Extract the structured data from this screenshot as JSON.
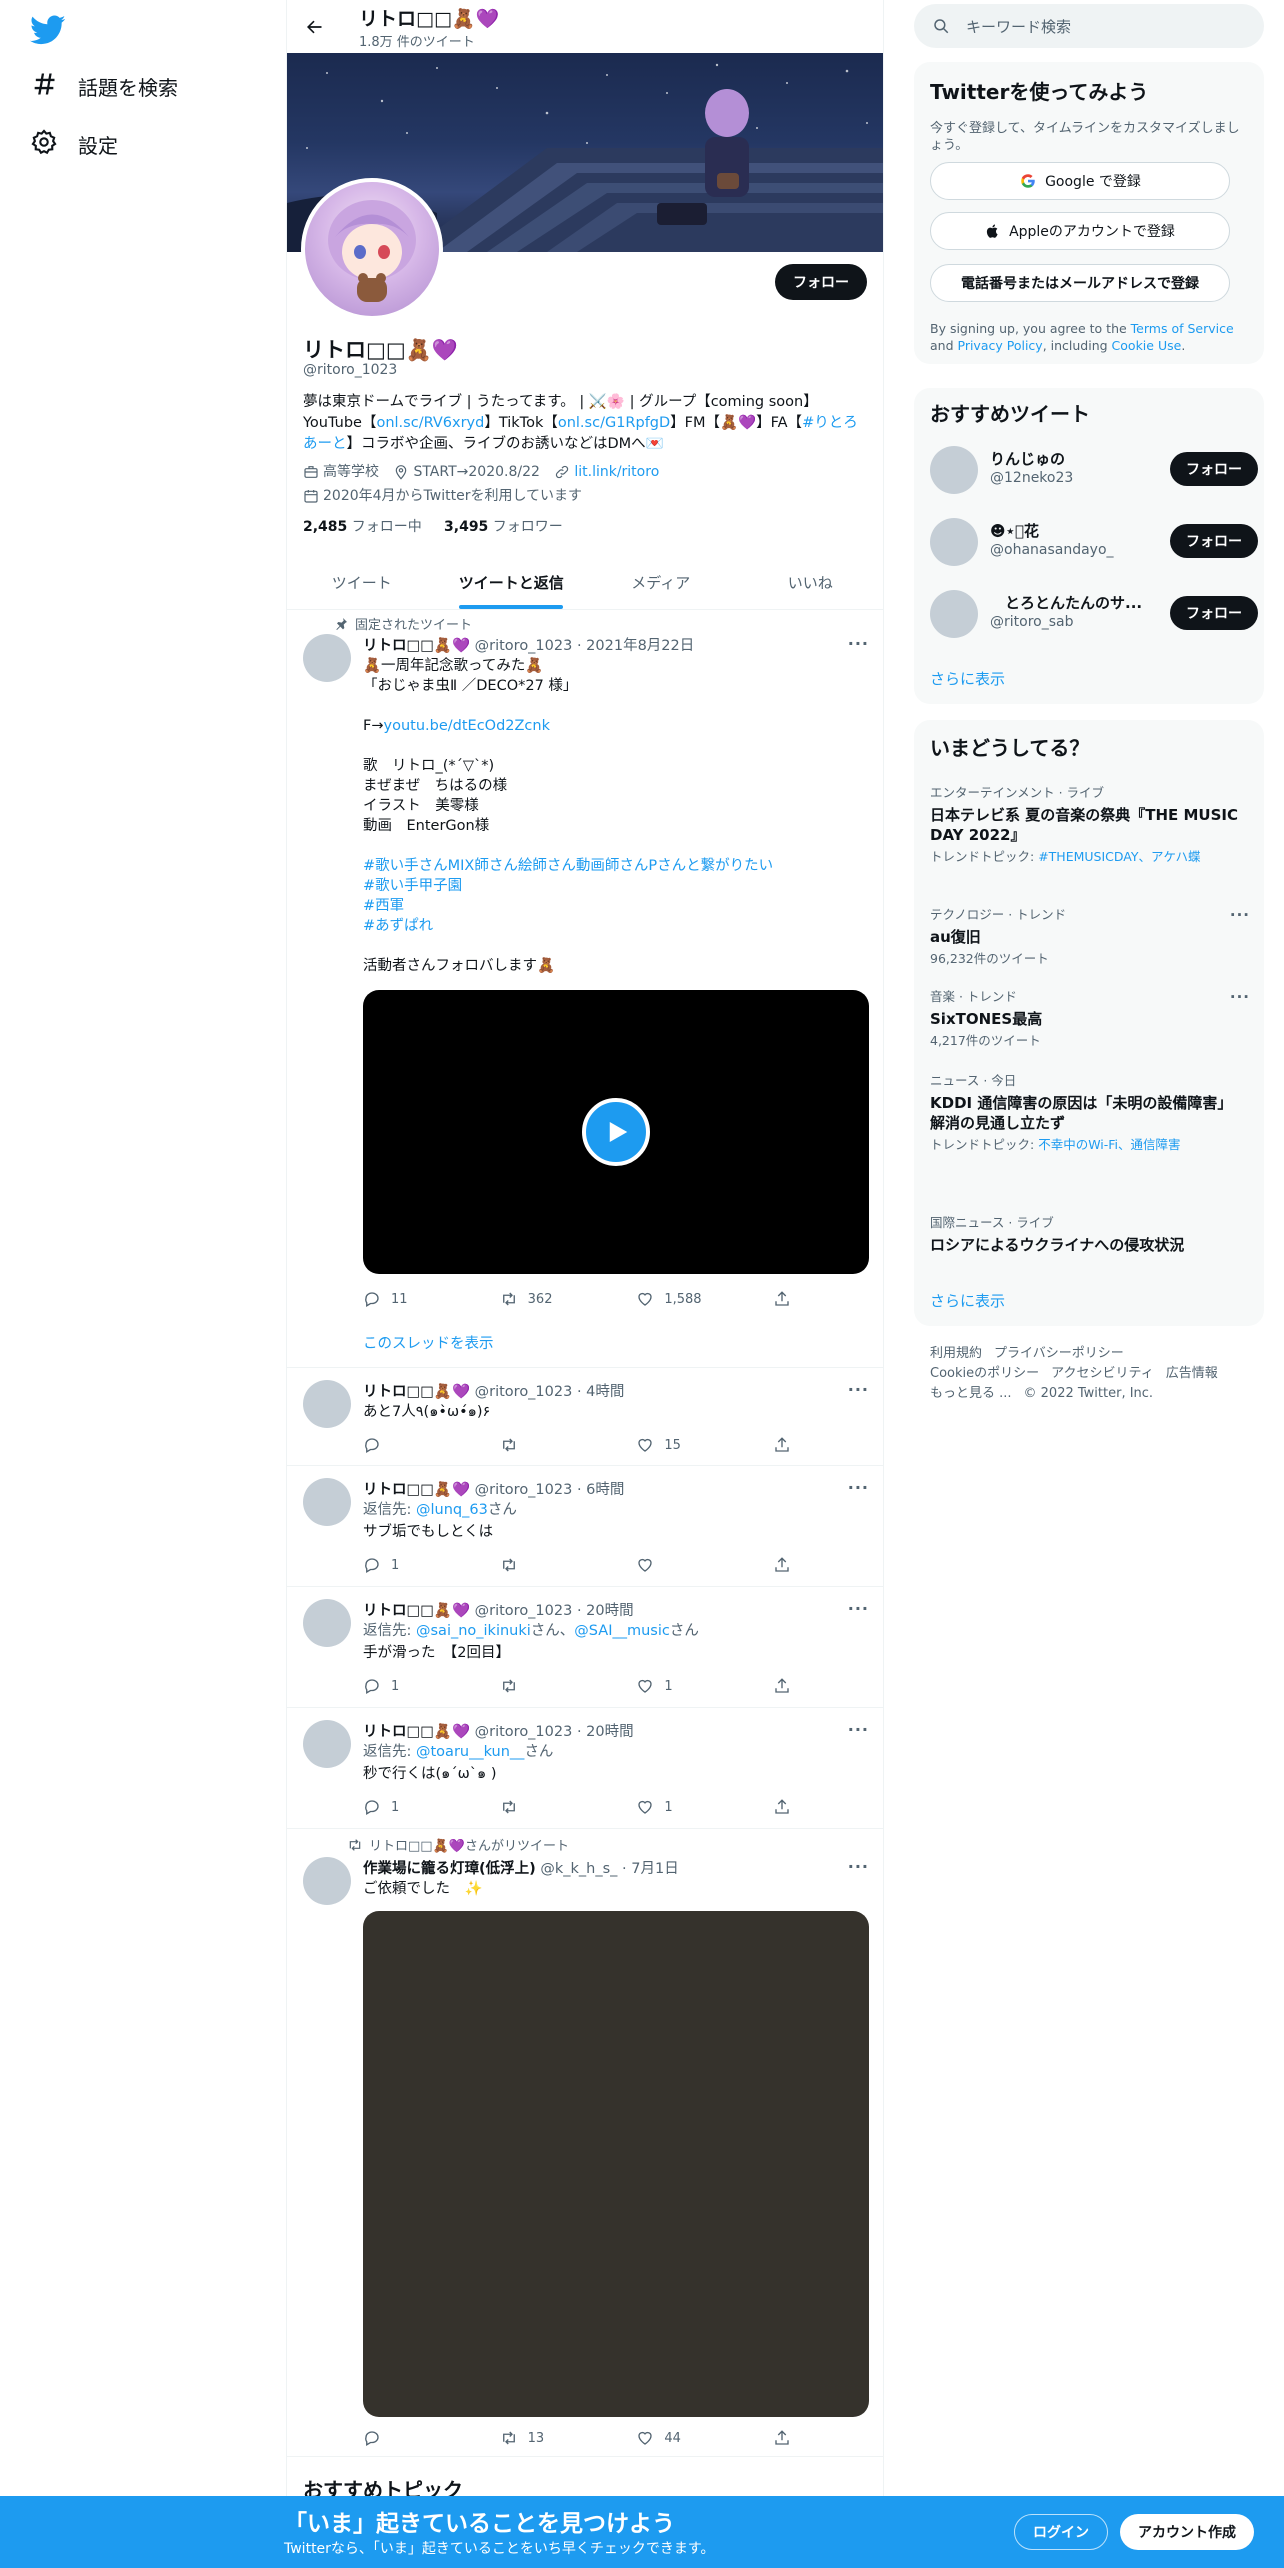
{
  "colors": {
    "accent": "#1d9bf0",
    "text": "#0f1419",
    "muted": "#536471",
    "bottom_bar": "#1d9bf0"
  },
  "nav": {
    "logo_icon": "twitter-bird-icon",
    "explore_label": "話題を検索",
    "settings_label": "設定"
  },
  "profile": {
    "topbar_name": "リトロ□□🧸💜",
    "topbar_count": "1.8万 件のツイート",
    "follow_label": "フォロー",
    "name": "リトロ□□🧸💜",
    "handle": "@ritoro_1023",
    "bio_line1": "夢は東京ドームでライブ | うたってます。 | ⚔️🌸 | グループ【coming soon】",
    "bio_line2_prefix": "YouTube【",
    "bio_link_youtube": "onl.sc/RV6xryd",
    "bio_tiktok_prefix": "】TikTok【",
    "bio_link_tiktok": "onl.sc/G1RpfgD",
    "bio_fm": "】FM【🧸💜】FA【",
    "bio_link_fa": "#りとろあーと",
    "bio_line3": "】コラボや企画、ライブのお誘いなどはDMへ💌",
    "meta_school": "高等学校",
    "meta_location": "START→2020.8/22",
    "meta_link": "lit.link/ritoro",
    "meta_joined": "2020年4月からTwitterを利用しています",
    "following_count": "2,485",
    "following_label": "フォロー中",
    "followers_count": "3,495",
    "followers_label": "フォロワー"
  },
  "tabs": [
    {
      "label": "ツイート"
    },
    {
      "label": "ツイートと返信"
    },
    {
      "label": "メディア"
    },
    {
      "label": "いいね"
    }
  ],
  "tweets": {
    "pinned": {
      "social": "固定されたツイート",
      "name": "リトロ□□🧸💜",
      "meta": "@ritoro_1023 · 2021年8月22日",
      "line1": "🧸一周年記念歌ってみた🧸",
      "line2": "「おじゃま虫Ⅱ ／DECO*27 様」",
      "f_prefix": "F→",
      "f_link": "youtu.be/dtEcOd2Zcnk",
      "credits": "歌　リトロ_(*ˊ▽ˋ*)\nまぜまぜ　ちはるの様\nイラスト　美零様\n動画　EnterGon様",
      "hashtags": "#歌い手さんMIX師さん絵師さん動画師さんPさんと繋がりたい\n#歌い手甲子園\n#西軍\n#あずぱれ",
      "closing": "活動者さんフォロバします🧸",
      "replies": "11",
      "retweets": "362",
      "likes": "1,588",
      "thread_label": "このスレッドを表示"
    },
    "t2": {
      "name": "リトロ□□🧸💜",
      "meta": "@ritoro_1023 · 4時間",
      "text": "あと7人٩(๑•̀ω•́๑)۶",
      "replies": "",
      "retweets": "",
      "likes": "15"
    },
    "t3": {
      "name": "リトロ□□🧸💜",
      "meta": "@ritoro_1023 · 6時間",
      "reply_prefix": "返信先: ",
      "reply_user": "@lunq_63",
      "reply_suffix": "さん",
      "text": "サブ垢でもしとくは",
      "replies": "1",
      "retweets": "",
      "likes": ""
    },
    "t4": {
      "name": "リトロ□□🧸💜",
      "meta": "@ritoro_1023 · 20時間",
      "reply_prefix": "返信先: ",
      "reply_user": "@sai_no_ikinuki",
      "reply_mid": "さん、",
      "reply_user2": "@SAI__music",
      "reply_suffix": "さん",
      "text": "手が滑った　【2回目】",
      "replies": "1",
      "retweets": "",
      "likes": "1"
    },
    "t5": {
      "name": "リトロ□□🧸💜",
      "meta": "@ritoro_1023 · 20時間",
      "reply_prefix": "返信先: ",
      "reply_user": "@toaru__kun__",
      "reply_suffix": "さん",
      "text": "秒で行くは(๑ˊωˋ๑ )",
      "replies": "1",
      "retweets": "",
      "likes": "1"
    },
    "t6": {
      "social": "リトロ□□🧸💜さんがリツイート",
      "name": "作業場に籠る灯璋(低浮上)",
      "meta": "@k_k_h_s_ · 7月1日",
      "text": "ご依頼でした　✨",
      "replies": "",
      "retweets": "13",
      "likes": "44"
    }
  },
  "suggest_topics": "おすすめトピック",
  "right": {
    "search_placeholder": "キーワード検索",
    "signup": {
      "title": "Twitterを使ってみよう",
      "sub": "今すぐ登録して、タイムラインをカスタマイズしましょう。",
      "google": "Google で登録",
      "apple": "Appleのアカウントで登録",
      "phone": "電話番号またはメールアドレスで登録",
      "legal_a": "By signing up, you agree to the ",
      "legal_tos": "Terms of Service",
      "legal_and": " and ",
      "legal_pp": "Privacy Policy",
      "legal_inc": ", including ",
      "legal_cookie": "Cookie Use",
      "legal_end": "."
    },
    "who_to_follow": {
      "title": "おすすめツイート",
      "users": [
        {
          "name": "りんじゅの",
          "handle": "@12neko23",
          "button": "フォロー"
        },
        {
          "name": "☻︎︎⋆͛花",
          "handle": "@ohanasandayo_",
          "button": "フォロー"
        },
        {
          "name": "　とろとんたんのサ...",
          "handle": "@ritoro_sab",
          "button": "フォロー"
        }
      ],
      "show_more": "さらに表示"
    },
    "trends": {
      "title": "いまどうしてる？",
      "items": [
        {
          "context": "エンターテインメント · ライブ",
          "title": "日本テレビ系 夏の音楽の祭典『THE MUSIC DAY 2022』",
          "sub_prefix": "トレンドトピック: ",
          "sub_link": "#THEMUSICDAY、アケハ蝶"
        },
        {
          "context": "テクノロジー · トレンド",
          "title": "au復旧",
          "sub": "96,232件のツイート"
        },
        {
          "context": "音楽 · トレンド",
          "title": "SixTONES最高",
          "sub": "4,217件のツイート"
        },
        {
          "context": "ニュース · 今日",
          "title": "KDDI 通信障害の原因は「未明の設備障害」 解消の見通し立たず",
          "sub_prefix": "トレンドトピック: ",
          "sub_link": "不幸中のWi-Fi、通信障害"
        },
        {
          "context": "国際ニュース · ライブ",
          "title": "ロシアによるウクライナへの侵攻状況"
        }
      ],
      "show_more": "さらに表示"
    },
    "footer": {
      "terms": "利用規約",
      "privacy": "プライバシーポリシー",
      "cookie": "Cookieのポリシー",
      "accessibility": "アクセシビリティ",
      "ads": "広告情報",
      "more": "もっと見る ...",
      "copyright": "© 2022 Twitter, Inc."
    }
  },
  "bottom_bar": {
    "title": "「いま」起きていることを見つけよう",
    "sub": "Twitterなら、「いま」起きていることをいち早くチェックできます。",
    "login": "ログイン",
    "signup": "アカウント作成"
  }
}
